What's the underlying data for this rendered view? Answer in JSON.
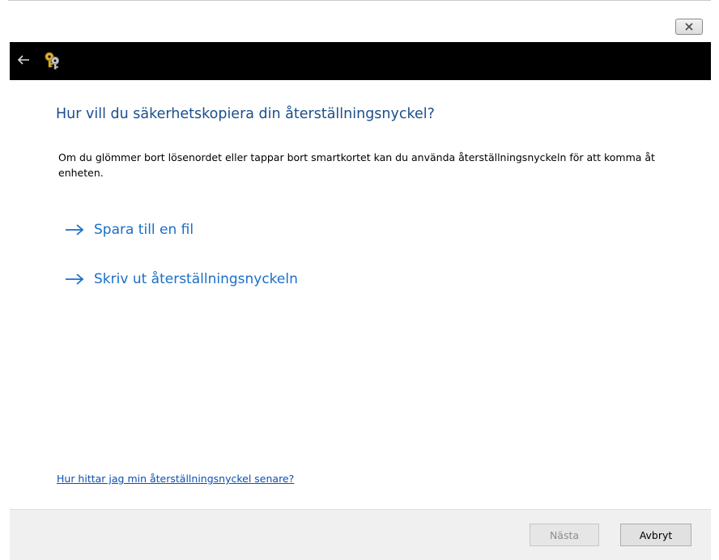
{
  "titlebar": {
    "close_icon": "close-icon"
  },
  "navbar": {
    "back_icon": "back-arrow-icon",
    "app_icon": "keys-icon"
  },
  "main": {
    "heading": "Hur vill du säkerhetskopiera din återställningsnyckel?",
    "description": "Om du glömmer bort lösenordet eller tappar bort smartkortet kan du använda återställningsnyckeln för att komma åt enheten.",
    "options": [
      {
        "label": "Spara till en fil",
        "icon": "right-arrow-icon"
      },
      {
        "label": "Skriv ut återställningsnyckeln",
        "icon": "right-arrow-icon"
      }
    ],
    "help_link": "Hur hittar jag min återställningsnyckel senare?"
  },
  "footer": {
    "next_label": "Nästa",
    "cancel_label": "Avbryt"
  },
  "colors": {
    "heading": "#1b4f8c",
    "option_link": "#1a6fc8",
    "help_link": "#0b4fb5",
    "navbar": "#000000",
    "footer": "#f0f0f0"
  }
}
